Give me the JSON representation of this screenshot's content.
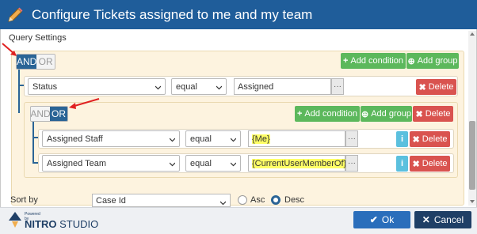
{
  "dialog": {
    "title": "Configure Tickets assigned to me and my team",
    "title_bar_color": "#1f5d9a"
  },
  "query": {
    "section_label": "Query Settings",
    "outer_group": {
      "and_label": "AND",
      "or_label": "OR",
      "selected": "AND",
      "add_condition_label": "Add condition",
      "add_group_label": "Add group",
      "rule": {
        "field": "Status",
        "operator": "equal",
        "value": "Assigned",
        "delete_label": "Delete"
      }
    },
    "inner_group": {
      "and_label": "AND",
      "or_label": "OR",
      "selected": "OR",
      "add_condition_label": "Add condition",
      "add_group_label": "Add group",
      "delete_label": "Delete",
      "rules": [
        {
          "field": "Assigned Staff",
          "operator": "equal",
          "value": "{Me}",
          "delete_label": "Delete"
        },
        {
          "field": "Assigned Team",
          "operator": "equal",
          "value": "{CurrentUserMemberOf}",
          "delete_label": "Delete"
        }
      ]
    }
  },
  "sort": {
    "label": "Sort by",
    "field": "Case Id",
    "asc_label": "Asc",
    "desc_label": "Desc",
    "selected": "Desc"
  },
  "footer": {
    "powered_by": "Powered by",
    "brand_bold": "NITRO",
    "brand_rest": "STUDIO",
    "ok_label": "Ok",
    "cancel_label": "Cancel"
  },
  "colors": {
    "accent": "#2a6496",
    "green": "#5cb85c",
    "red": "#d9534f",
    "info": "#5bc0de",
    "highlight": "#ffff66",
    "group_bg": "#fdf3df"
  },
  "icons": [
    "pencil-icon",
    "plus-icon",
    "times-icon",
    "info-icon",
    "check-icon",
    "ellipsis-icon",
    "chevron-down-icon",
    "nitro-logo-icon"
  ]
}
